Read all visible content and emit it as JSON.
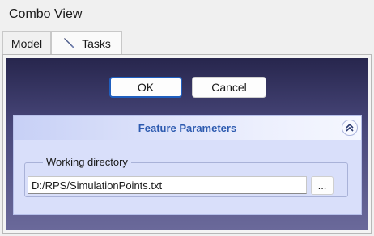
{
  "window": {
    "title": "Combo View"
  },
  "tabs": [
    {
      "label": "Model",
      "active": false
    },
    {
      "label": "Tasks",
      "active": true,
      "icon": "pencil-icon"
    }
  ],
  "dialog": {
    "ok_label": "OK",
    "cancel_label": "Cancel"
  },
  "panel": {
    "title": "Feature Parameters",
    "collapse_icon": "collapse-up-icon",
    "working_directory": {
      "label": "Working directory",
      "value": "D:/RPS/SimulationPoints.txt",
      "browse_label": "..."
    }
  },
  "colors": {
    "task_background_top": "#27264d",
    "task_background_bottom": "#6a699a",
    "panel_background": "#d9dffa",
    "panel_title": "#2d5bb0",
    "ok_border": "#1f5fbf"
  }
}
